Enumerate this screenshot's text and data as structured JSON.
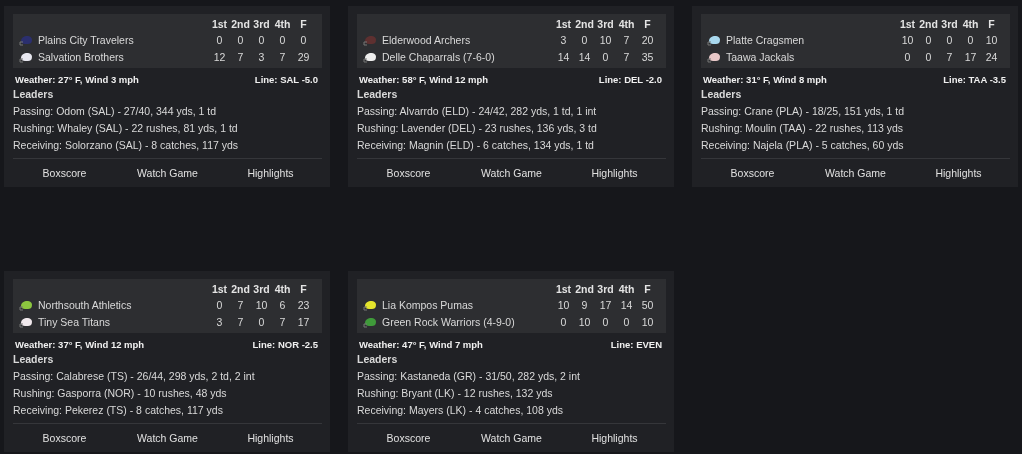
{
  "games": [
    {
      "periods": [
        "1st",
        "2nd",
        "3rd",
        "4th",
        "F"
      ],
      "teams": [
        {
          "name": "Plains City Travelers",
          "color": "#2b2f6e",
          "scores": [
            "0",
            "0",
            "0",
            "0",
            "0"
          ]
        },
        {
          "name": "Salvation Brothers",
          "color": "#e8e8f0",
          "scores": [
            "12",
            "7",
            "3",
            "7",
            "29"
          ]
        }
      ],
      "weather": "Weather: 27° F, Wind 3 mph",
      "line": "Line: SAL -5.0",
      "leaders_title": "Leaders",
      "leaders": [
        "Passing: Odom (SAL) - 27/40, 344 yds, 1 td",
        "Rushing: Whaley (SAL) - 22 rushes, 81 yds, 1 td",
        "Receiving: Solorzano (SAL) - 8 catches, 117 yds"
      ],
      "actions": [
        "Boxscore",
        "Watch Game",
        "Highlights"
      ]
    },
    {
      "periods": [
        "1st",
        "2nd",
        "3rd",
        "4th",
        "F"
      ],
      "teams": [
        {
          "name": "Elderwood Archers",
          "color": "#5e3030",
          "scores": [
            "3",
            "0",
            "10",
            "7",
            "20"
          ]
        },
        {
          "name": "Delle Chaparrals (7-6-0)",
          "color": "#eeeeee",
          "scores": [
            "14",
            "14",
            "0",
            "7",
            "35"
          ]
        }
      ],
      "weather": "Weather: 58° F, Wind 12 mph",
      "line": "Line: DEL -2.0",
      "leaders_title": "Leaders",
      "leaders": [
        "Passing: Alvarrdo (ELD) - 24/42, 282 yds, 1 td, 1 int",
        "Rushing: Lavender (DEL) - 23 rushes, 136 yds, 3 td",
        "Receiving: Magnin (ELD) - 6 catches, 134 yds, 1 td"
      ],
      "actions": [
        "Boxscore",
        "Watch Game",
        "Highlights"
      ]
    },
    {
      "periods": [
        "1st",
        "2nd",
        "3rd",
        "4th",
        "F"
      ],
      "teams": [
        {
          "name": "Platte Cragsmen",
          "color": "#a8d8ee",
          "scores": [
            "10",
            "0",
            "0",
            "0",
            "10"
          ]
        },
        {
          "name": "Taawa Jackals",
          "color": "#e8c8c8",
          "scores": [
            "0",
            "0",
            "7",
            "17",
            "24"
          ]
        }
      ],
      "weather": "Weather: 31° F, Wind 8 mph",
      "line": "Line: TAA -3.5",
      "leaders_title": "Leaders",
      "leaders": [
        "Passing: Crane (PLA) - 18/25, 151 yds, 1 td",
        "Rushing: Moulin (TAA) - 22 rushes, 113 yds",
        "Receiving: Najela (PLA) - 5 catches, 60 yds"
      ],
      "actions": [
        "Boxscore",
        "Watch Game",
        "Highlights"
      ]
    },
    {
      "periods": [
        "1st",
        "2nd",
        "3rd",
        "4th",
        "F"
      ],
      "teams": [
        {
          "name": "Northsouth Athletics",
          "color": "#8cc63f",
          "scores": [
            "0",
            "7",
            "10",
            "6",
            "23"
          ]
        },
        {
          "name": "Tiny Sea Titans",
          "color": "#f0e8ec",
          "scores": [
            "3",
            "7",
            "0",
            "7",
            "17"
          ]
        }
      ],
      "weather": "Weather: 37° F, Wind 12 mph",
      "line": "Line: NOR -2.5",
      "leaders_title": "Leaders",
      "leaders": [
        "Passing: Calabrese (TS) - 26/44, 298 yds, 2 td, 2 int",
        "Rushing: Gasporra (NOR) - 10 rushes, 48 yds",
        "Receiving: Pekerez (TS) - 8 catches, 117 yds"
      ],
      "actions": [
        "Boxscore",
        "Watch Game",
        "Highlights"
      ]
    },
    {
      "periods": [
        "1st",
        "2nd",
        "3rd",
        "4th",
        "F"
      ],
      "teams": [
        {
          "name": "Lia Kompos Pumas",
          "color": "#e4e42c",
          "scores": [
            "10",
            "9",
            "17",
            "14",
            "50"
          ]
        },
        {
          "name": "Green Rock Warriors (4-9-0)",
          "color": "#3f9a3a",
          "scores": [
            "0",
            "10",
            "0",
            "0",
            "10"
          ]
        }
      ],
      "weather": "Weather: 47° F, Wind 7 mph",
      "line": "Line: EVEN",
      "leaders_title": "Leaders",
      "leaders": [
        "Passing: Kastaneda (GR) - 31/50, 282 yds, 2 int",
        "Rushing: Bryant (LK) - 12 rushes, 132 yds",
        "Receiving: Mayers (LK) - 4 catches, 108 yds"
      ],
      "actions": [
        "Boxscore",
        "Watch Game",
        "Highlights"
      ]
    }
  ]
}
